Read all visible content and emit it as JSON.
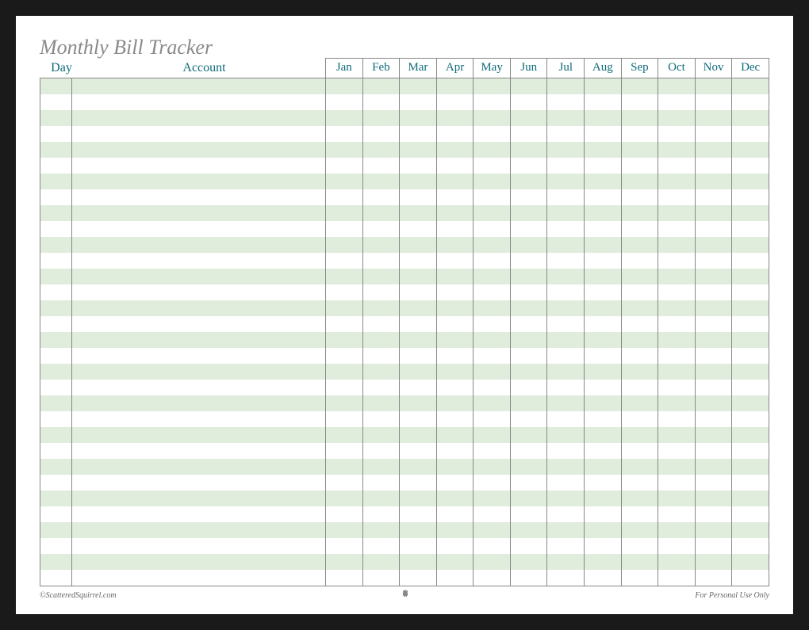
{
  "title": "Monthly Bill Tracker",
  "columns": {
    "day": "Day",
    "account": "Account"
  },
  "months": [
    "Jan",
    "Feb",
    "Mar",
    "Apr",
    "May",
    "Jun",
    "Jul",
    "Aug",
    "Sep",
    "Oct",
    "Nov",
    "Dec"
  ],
  "row_count": 32,
  "footer": {
    "left": "©ScatteredSquirrel.com",
    "right": "For Personal Use Only"
  },
  "colors": {
    "title": "#8a8a8a",
    "headers": "#0f6b7a",
    "shaded_row": "#e0ecdc",
    "border": "#888888"
  }
}
